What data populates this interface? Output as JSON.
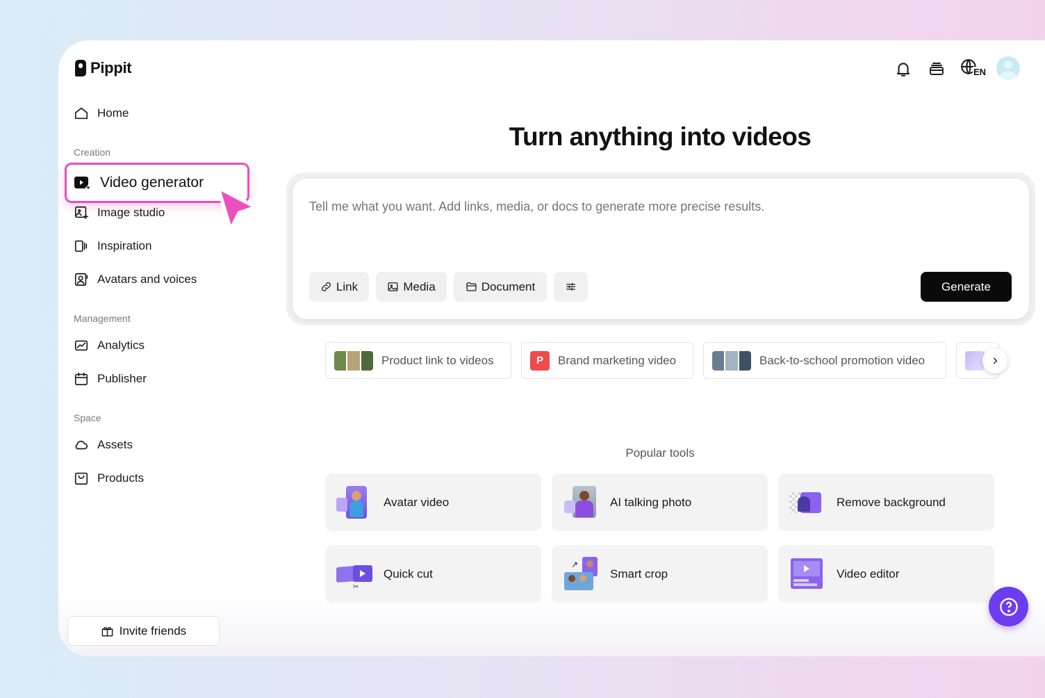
{
  "app": {
    "name": "Pippit"
  },
  "header": {
    "language_badge": "EN"
  },
  "sidebar": {
    "home": "Home",
    "sections": {
      "creation": "Creation",
      "management": "Management",
      "space": "Space"
    },
    "creation_items": [
      "Video generator",
      "Image studio",
      "Inspiration",
      "Avatars and voices"
    ],
    "management_items": [
      "Analytics",
      "Publisher"
    ],
    "space_items": [
      "Assets",
      "Products"
    ],
    "selected": "Video generator",
    "invite_label": "Invite friends"
  },
  "main": {
    "headline": "Turn anything into videos",
    "prompt_placeholder": "Tell me what you want. Add links, media, or docs to generate more precise results.",
    "chips": {
      "link": "Link",
      "media": "Media",
      "document": "Document"
    },
    "generate_label": "Generate",
    "suggestions": [
      "Product link to videos",
      "Brand marketing video",
      "Back-to-school promotion video"
    ],
    "brand_badge": "P",
    "popular_title": "Popular tools",
    "tools": [
      "Avatar video",
      "AI talking photo",
      "Remove background",
      "Quick cut",
      "Smart crop",
      "Video editor"
    ]
  },
  "colors": {
    "accent": "#6c3cf0",
    "highlight": "#ec4fb8",
    "primary_button": "#0a0a0a"
  }
}
